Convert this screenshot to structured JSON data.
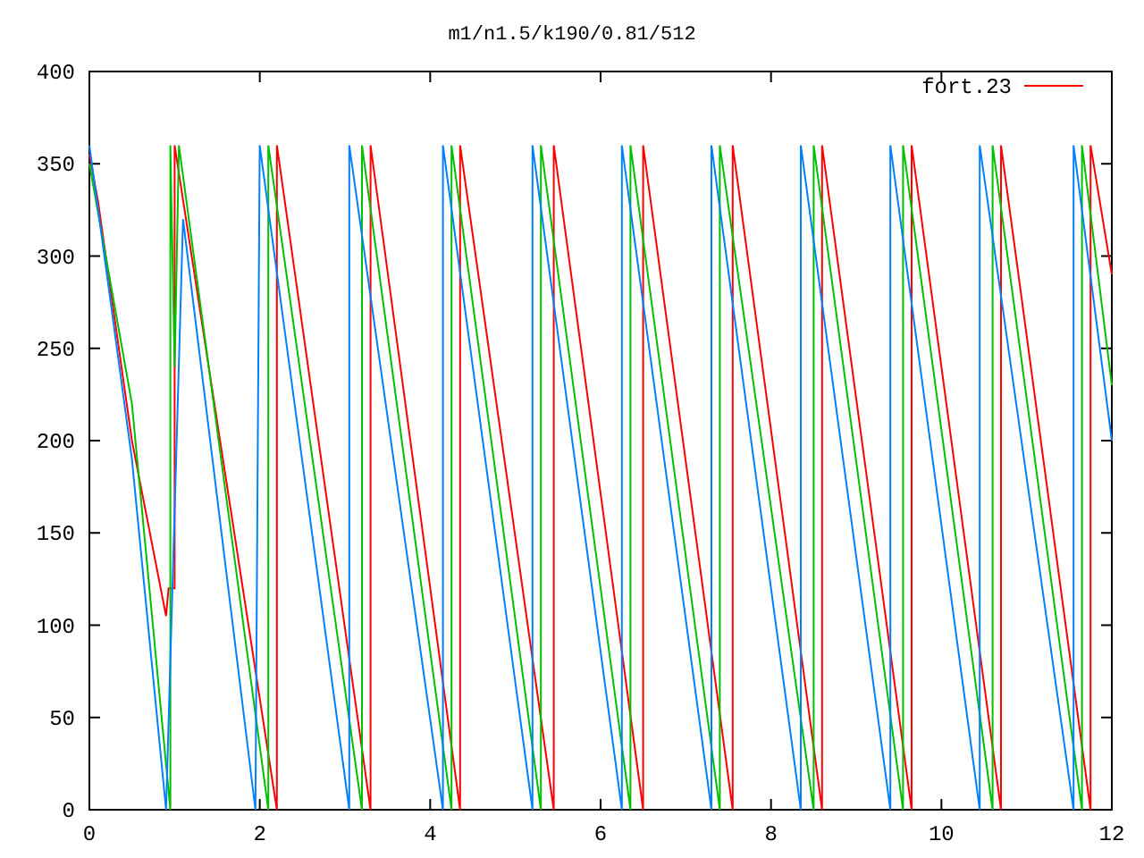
{
  "chart_data": {
    "type": "line",
    "title": "m1/n1.5/k190/0.81/512",
    "xlim": [
      0,
      12
    ],
    "ylim": [
      0,
      400
    ],
    "xticks": [
      0,
      2,
      4,
      6,
      8,
      10,
      12
    ],
    "yticks": [
      0,
      50,
      100,
      150,
      200,
      250,
      300,
      350,
      400
    ],
    "series": [
      {
        "name": "fort.23",
        "color": "#ff0000",
        "x": [
          0,
          0.1,
          0.5,
          0.9,
          0.93,
          1.0,
          1.0,
          2.2,
          2.2,
          3.3,
          3.3,
          4.35,
          4.35,
          5.45,
          5.45,
          6.5,
          6.5,
          7.55,
          7.55,
          8.6,
          8.6,
          9.65,
          9.65,
          10.7,
          10.7,
          11.75,
          11.75,
          12
        ],
        "values": [
          355,
          330,
          200,
          105,
          120,
          120,
          360,
          0,
          360,
          0,
          360,
          0,
          360,
          0,
          360,
          0,
          360,
          0,
          360,
          0,
          360,
          0,
          360,
          0,
          360,
          0,
          360,
          290
        ]
      },
      {
        "color": "#00c000",
        "x": [
          0,
          0.5,
          0.95,
          0.95,
          1.0,
          1.05,
          2.1,
          2.1,
          3.2,
          3.2,
          4.25,
          4.25,
          5.3,
          5.3,
          6.35,
          6.35,
          7.4,
          7.4,
          8.5,
          8.5,
          9.55,
          9.55,
          10.6,
          10.6,
          11.65,
          11.65,
          12
        ],
        "values": [
          350,
          220,
          0,
          360,
          240,
          360,
          0,
          360,
          0,
          360,
          0,
          360,
          0,
          360,
          0,
          360,
          0,
          360,
          0,
          360,
          0,
          360,
          0,
          360,
          0,
          360,
          230
        ]
      },
      {
        "color": "#0080ff",
        "x": [
          0,
          0.5,
          0.9,
          1.1,
          1.95,
          2.0,
          3.05,
          3.05,
          4.15,
          4.15,
          5.2,
          5.2,
          6.25,
          6.25,
          7.3,
          7.3,
          8.35,
          8.35,
          9.4,
          9.4,
          10.45,
          10.45,
          11.55,
          11.55,
          12
        ],
        "values": [
          360,
          190,
          0,
          320,
          0,
          360,
          0,
          360,
          0,
          360,
          0,
          360,
          0,
          360,
          0,
          360,
          0,
          360,
          0,
          360,
          0,
          360,
          0,
          360,
          200
        ]
      }
    ]
  }
}
